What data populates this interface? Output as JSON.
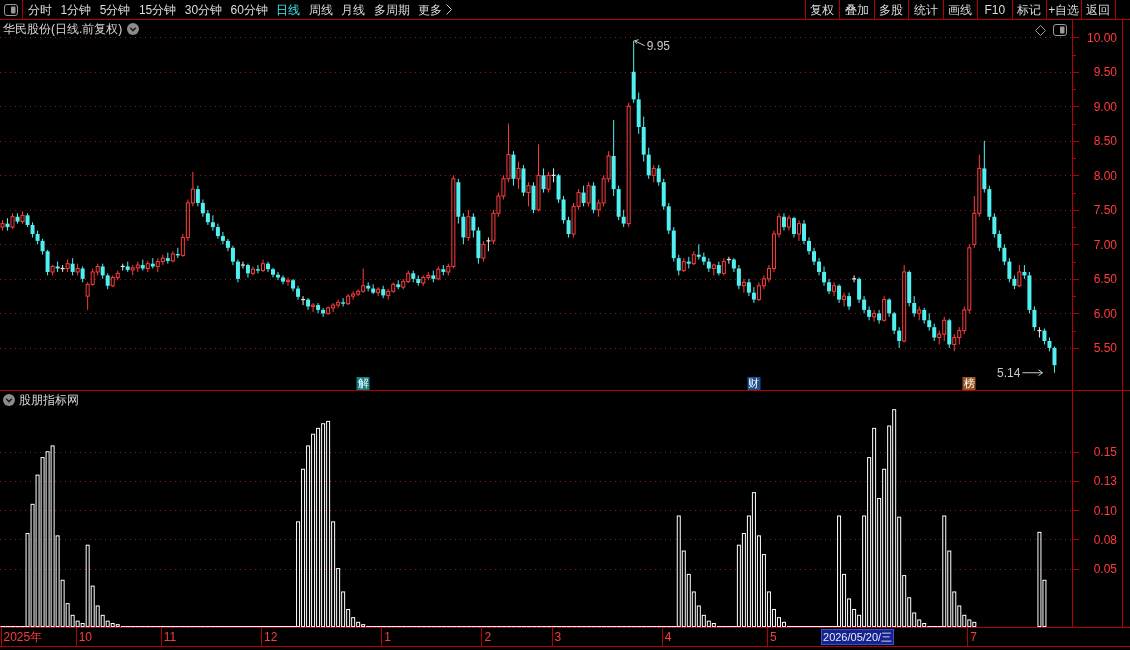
{
  "toolbar": {
    "periods": [
      {
        "label": "分时",
        "selected": false
      },
      {
        "label": "1分钟",
        "selected": false
      },
      {
        "label": "5分钟",
        "selected": false
      },
      {
        "label": "15分钟",
        "selected": false
      },
      {
        "label": "30分钟",
        "selected": false
      },
      {
        "label": "60分钟",
        "selected": false
      },
      {
        "label": "日线",
        "selected": true
      },
      {
        "label": "周线",
        "selected": false
      },
      {
        "label": "月线",
        "selected": false
      },
      {
        "label": "多周期",
        "selected": false
      }
    ],
    "more_menu": {
      "label": "更多"
    },
    "buttons": [
      "复权",
      "叠加",
      "多股",
      "统计",
      "画线",
      "F10",
      "标记",
      "+自选",
      "返回"
    ]
  },
  "price_pane": {
    "title": "华民股份(日线.前复权)",
    "events": [
      {
        "label": "解",
        "color": "#0e7d80"
      },
      {
        "label": "财",
        "color": "#1f4e8c"
      },
      {
        "label": "榜",
        "color": "#9a5224"
      }
    ],
    "chart_data": [
      {
        "type": "candlestick",
        "ylim": [
          4.89,
          10.25
        ],
        "yticks": [
          {
            "value": 5.5,
            "label": "5.50"
          },
          {
            "value": 6,
            "label": "6.00"
          },
          {
            "value": 6.5,
            "label": "6.50"
          },
          {
            "value": 7,
            "label": "7.00"
          },
          {
            "value": 7.5,
            "label": "7.50"
          },
          {
            "value": 8,
            "label": "8.00"
          },
          {
            "value": 8.5,
            "label": "8.50"
          },
          {
            "value": 9,
            "label": "9.00"
          },
          {
            "value": 9.5,
            "label": "9.50"
          },
          {
            "value": 10,
            "label": "10.00"
          }
        ],
        "grid": true,
        "annotations": [
          "9.95",
          "5.14"
        ],
        "ohlc": [
          [
            7.25,
            7.35,
            7.2,
            7.3
          ],
          [
            7.3,
            7.38,
            7.2,
            7.25
          ],
          [
            7.25,
            7.45,
            7.22,
            7.4
          ],
          [
            7.4,
            7.45,
            7.3,
            7.33
          ],
          [
            7.33,
            7.48,
            7.3,
            7.42
          ],
          [
            7.42,
            7.45,
            7.25,
            7.28
          ],
          [
            7.28,
            7.32,
            7.1,
            7.15
          ],
          [
            7.15,
            7.2,
            7.0,
            7.05
          ],
          [
            7.05,
            7.08,
            6.85,
            6.9
          ],
          [
            6.9,
            6.92,
            6.55,
            6.6
          ],
          [
            6.6,
            6.7,
            6.55,
            6.68
          ],
          [
            6.68,
            6.75,
            6.6,
            6.65
          ],
          [
            6.65,
            6.7,
            6.6,
            6.65
          ],
          [
            6.65,
            6.78,
            6.6,
            6.72
          ],
          [
            6.72,
            6.8,
            6.55,
            6.6
          ],
          [
            6.6,
            6.72,
            6.55,
            6.65
          ],
          [
            6.65,
            6.68,
            6.45,
            6.5
          ],
          [
            6.25,
            6.45,
            6.05,
            6.42
          ],
          [
            6.42,
            6.65,
            6.4,
            6.6
          ],
          [
            6.6,
            6.72,
            6.55,
            6.68
          ],
          [
            6.68,
            6.72,
            6.5,
            6.55
          ],
          [
            6.55,
            6.58,
            6.35,
            6.4
          ],
          [
            6.4,
            6.55,
            6.38,
            6.52
          ],
          [
            6.52,
            6.62,
            6.48,
            6.58
          ],
          [
            6.68,
            6.72,
            6.62,
            6.68
          ],
          [
            6.68,
            6.75,
            6.6,
            6.63
          ],
          [
            6.63,
            6.7,
            6.55,
            6.66
          ],
          [
            6.66,
            6.75,
            6.6,
            6.7
          ],
          [
            6.7,
            6.78,
            6.62,
            6.65
          ],
          [
            6.65,
            6.76,
            6.6,
            6.72
          ],
          [
            6.72,
            6.8,
            6.65,
            6.68
          ],
          [
            6.68,
            6.8,
            6.6,
            6.75
          ],
          [
            6.75,
            6.85,
            6.7,
            6.8
          ],
          [
            6.8,
            6.88,
            6.72,
            6.76
          ],
          [
            6.76,
            6.9,
            6.74,
            6.86
          ],
          [
            6.86,
            6.95,
            6.8,
            6.84
          ],
          [
            6.84,
            7.15,
            6.82,
            7.1
          ],
          [
            7.1,
            7.65,
            7.05,
            7.6
          ],
          [
            7.6,
            8.05,
            7.55,
            7.8
          ],
          [
            7.8,
            7.85,
            7.55,
            7.6
          ],
          [
            7.6,
            7.65,
            7.4,
            7.45
          ],
          [
            7.45,
            7.5,
            7.28,
            7.32
          ],
          [
            7.32,
            7.42,
            7.2,
            7.25
          ],
          [
            7.25,
            7.3,
            7.08,
            7.12
          ],
          [
            7.12,
            7.18,
            7.0,
            7.05
          ],
          [
            7.05,
            7.08,
            6.9,
            6.95
          ],
          [
            6.95,
            6.98,
            6.7,
            6.75
          ],
          [
            6.75,
            6.78,
            6.45,
            6.5
          ],
          [
            6.7,
            6.75,
            6.65,
            6.7
          ],
          [
            6.7,
            6.72,
            6.52,
            6.58
          ],
          [
            6.58,
            6.68,
            6.55,
            6.64
          ],
          [
            6.64,
            6.7,
            6.58,
            6.62
          ],
          [
            6.62,
            6.78,
            6.6,
            6.72
          ],
          [
            6.72,
            6.75,
            6.6,
            6.64
          ],
          [
            6.64,
            6.66,
            6.52,
            6.56
          ],
          [
            6.56,
            6.6,
            6.48,
            6.52
          ],
          [
            6.52,
            6.55,
            6.42,
            6.46
          ],
          [
            6.46,
            6.52,
            6.4,
            6.48
          ],
          [
            6.48,
            6.5,
            6.32,
            6.36
          ],
          [
            6.36,
            6.4,
            6.2,
            6.24
          ],
          [
            6.2,
            6.25,
            6.12,
            6.2
          ],
          [
            6.2,
            6.22,
            6.05,
            6.1
          ],
          [
            6.1,
            6.15,
            6.02,
            6.12
          ],
          [
            6.12,
            6.15,
            6.0,
            6.05
          ],
          [
            6.05,
            6.08,
            5.95,
            6.0
          ],
          [
            6.0,
            6.1,
            5.98,
            6.08
          ],
          [
            6.08,
            6.15,
            6.02,
            6.12
          ],
          [
            6.12,
            6.2,
            6.08,
            6.16
          ],
          [
            6.16,
            6.22,
            6.1,
            6.14
          ],
          [
            6.14,
            6.28,
            6.12,
            6.25
          ],
          [
            6.25,
            6.32,
            6.2,
            6.28
          ],
          [
            6.28,
            6.35,
            6.25,
            6.32
          ],
          [
            6.32,
            6.65,
            6.3,
            6.4
          ],
          [
            6.4,
            6.45,
            6.32,
            6.36
          ],
          [
            6.36,
            6.42,
            6.28,
            6.3
          ],
          [
            6.3,
            6.38,
            6.25,
            6.35
          ],
          [
            6.35,
            6.4,
            6.22,
            6.26
          ],
          [
            6.26,
            6.35,
            6.2,
            6.32
          ],
          [
            6.32,
            6.45,
            6.3,
            6.42
          ],
          [
            6.42,
            6.48,
            6.35,
            6.38
          ],
          [
            6.38,
            6.5,
            6.35,
            6.46
          ],
          [
            6.46,
            6.62,
            6.44,
            6.58
          ],
          [
            6.58,
            6.62,
            6.45,
            6.5
          ],
          [
            6.5,
            6.55,
            6.4,
            6.44
          ],
          [
            6.44,
            6.55,
            6.4,
            6.52
          ],
          [
            6.52,
            6.6,
            6.48,
            6.55
          ],
          [
            6.55,
            6.62,
            6.45,
            6.5
          ],
          [
            6.5,
            6.68,
            6.48,
            6.64
          ],
          [
            6.64,
            6.7,
            6.55,
            6.6
          ],
          [
            6.6,
            6.72,
            6.55,
            6.68
          ],
          [
            6.68,
            8.0,
            6.65,
            7.95
          ],
          [
            7.9,
            7.95,
            7.3,
            7.4
          ],
          [
            7.4,
            7.45,
            7.0,
            7.1
          ],
          [
            7.1,
            7.5,
            7.05,
            7.4
          ],
          [
            7.4,
            7.45,
            7.1,
            7.2
          ],
          [
            7.2,
            7.25,
            6.72,
            6.8
          ],
          [
            6.8,
            7.05,
            6.75,
            7.0
          ],
          [
            7.05,
            7.1,
            6.9,
            7.05
          ],
          [
            7.05,
            7.5,
            7.0,
            7.45
          ],
          [
            7.45,
            7.75,
            7.4,
            7.7
          ],
          [
            7.7,
            8.0,
            7.65,
            7.95
          ],
          [
            7.95,
            8.75,
            7.9,
            8.3
          ],
          [
            8.3,
            8.35,
            7.85,
            7.95
          ],
          [
            7.95,
            8.2,
            7.8,
            8.1
          ],
          [
            8.1,
            8.15,
            7.7,
            7.75
          ],
          [
            7.75,
            7.9,
            7.55,
            7.85
          ],
          [
            7.85,
            7.9,
            7.45,
            7.5
          ],
          [
            7.5,
            8.45,
            7.48,
            8.0
          ],
          [
            8.0,
            8.1,
            7.75,
            7.8
          ],
          [
            7.8,
            8.05,
            7.75,
            8.0
          ],
          [
            8.0,
            8.1,
            7.9,
            8.0
          ],
          [
            8.0,
            8.02,
            7.6,
            7.65
          ],
          [
            7.65,
            7.7,
            7.3,
            7.35
          ],
          [
            7.35,
            7.4,
            7.1,
            7.15
          ],
          [
            7.15,
            7.6,
            7.1,
            7.55
          ],
          [
            7.55,
            7.8,
            7.5,
            7.75
          ],
          [
            7.75,
            7.85,
            7.55,
            7.6
          ],
          [
            7.6,
            7.9,
            7.55,
            7.85
          ],
          [
            7.85,
            7.9,
            7.45,
            7.5
          ],
          [
            7.5,
            7.65,
            7.4,
            7.6
          ],
          [
            7.6,
            8.0,
            7.55,
            7.95
          ],
          [
            7.95,
            8.35,
            7.9,
            8.28
          ],
          [
            8.28,
            8.8,
            7.7,
            7.8
          ],
          [
            7.8,
            7.85,
            7.35,
            7.4
          ],
          [
            7.4,
            7.5,
            7.25,
            7.3
          ],
          [
            7.3,
            9.05,
            7.25,
            9.0
          ],
          [
            9.5,
            9.95,
            9.05,
            9.1
          ],
          [
            9.1,
            9.2,
            8.6,
            8.7
          ],
          [
            8.7,
            8.85,
            8.2,
            8.3
          ],
          [
            8.3,
            8.4,
            7.95,
            8.0
          ],
          [
            8.0,
            8.15,
            7.9,
            8.1
          ],
          [
            8.1,
            8.15,
            7.85,
            7.9
          ],
          [
            7.9,
            7.95,
            7.5,
            7.55
          ],
          [
            7.55,
            7.6,
            7.15,
            7.2
          ],
          [
            7.2,
            7.25,
            6.75,
            6.8
          ],
          [
            6.8,
            6.85,
            6.55,
            6.62
          ],
          [
            6.62,
            6.8,
            6.6,
            6.75
          ],
          [
            6.75,
            6.82,
            6.65,
            6.72
          ],
          [
            6.72,
            6.9,
            6.7,
            6.85
          ],
          [
            6.85,
            7.0,
            6.78,
            6.82
          ],
          [
            6.82,
            6.88,
            6.7,
            6.75
          ],
          [
            6.75,
            6.8,
            6.6,
            6.65
          ],
          [
            6.65,
            6.72,
            6.55,
            6.7
          ],
          [
            6.7,
            6.75,
            6.55,
            6.58
          ],
          [
            6.58,
            6.8,
            6.55,
            6.75
          ],
          [
            6.78,
            6.82,
            6.72,
            6.78
          ],
          [
            6.78,
            6.8,
            6.6,
            6.65
          ],
          [
            6.65,
            6.7,
            6.35,
            6.4
          ],
          [
            6.4,
            6.5,
            6.3,
            6.45
          ],
          [
            6.45,
            6.5,
            6.25,
            6.3
          ],
          [
            6.3,
            6.38,
            6.15,
            6.2
          ],
          [
            6.2,
            6.45,
            6.18,
            6.4
          ],
          [
            6.4,
            6.55,
            6.35,
            6.5
          ],
          [
            6.5,
            6.7,
            6.45,
            6.65
          ],
          [
            6.65,
            7.2,
            6.6,
            7.15
          ],
          [
            7.15,
            7.45,
            7.1,
            7.4
          ],
          [
            7.4,
            7.45,
            7.2,
            7.25
          ],
          [
            7.25,
            7.42,
            7.2,
            7.38
          ],
          [
            7.38,
            7.4,
            7.1,
            7.15
          ],
          [
            7.15,
            7.35,
            7.05,
            7.3
          ],
          [
            7.3,
            7.35,
            7.0,
            7.05
          ],
          [
            7.05,
            7.1,
            6.85,
            6.9
          ],
          [
            6.9,
            6.95,
            6.7,
            6.75
          ],
          [
            6.75,
            6.8,
            6.55,
            6.6
          ],
          [
            6.6,
            6.68,
            6.4,
            6.45
          ],
          [
            6.45,
            6.5,
            6.28,
            6.32
          ],
          [
            6.32,
            6.45,
            6.25,
            6.4
          ],
          [
            6.4,
            6.42,
            6.15,
            6.2
          ],
          [
            6.2,
            6.3,
            6.1,
            6.25
          ],
          [
            6.25,
            6.3,
            6.05,
            6.1
          ],
          [
            6.5,
            6.55,
            6.45,
            6.5
          ],
          [
            6.5,
            6.52,
            6.15,
            6.2
          ],
          [
            6.2,
            6.25,
            6.0,
            6.05
          ],
          [
            6.05,
            6.1,
            5.9,
            5.95
          ],
          [
            5.95,
            6.05,
            5.88,
            6.0
          ],
          [
            6.0,
            6.05,
            5.85,
            5.9
          ],
          [
            5.9,
            6.25,
            5.88,
            6.2
          ],
          [
            6.2,
            6.22,
            5.95,
            6.0
          ],
          [
            6.0,
            6.02,
            5.7,
            5.75
          ],
          [
            5.75,
            5.8,
            5.5,
            5.6
          ],
          [
            5.6,
            6.7,
            5.58,
            6.6
          ],
          [
            6.6,
            6.62,
            6.1,
            6.15
          ],
          [
            6.15,
            6.25,
            5.95,
            6.0
          ],
          [
            6.0,
            6.1,
            5.9,
            6.05
          ],
          [
            6.05,
            6.08,
            5.85,
            5.9
          ],
          [
            5.9,
            6.0,
            5.75,
            5.8
          ],
          [
            5.8,
            5.85,
            5.6,
            5.65
          ],
          [
            5.65,
            5.75,
            5.55,
            5.7
          ],
          [
            5.7,
            5.95,
            5.6,
            5.9
          ],
          [
            5.9,
            5.92,
            5.5,
            5.55
          ],
          [
            5.55,
            5.7,
            5.45,
            5.65
          ],
          [
            5.65,
            5.8,
            5.55,
            5.75
          ],
          [
            5.75,
            6.1,
            5.7,
            6.05
          ],
          [
            6.05,
            7.0,
            6.0,
            6.95
          ],
          [
            7.0,
            7.7,
            6.95,
            7.45
          ],
          [
            7.45,
            8.3,
            7.4,
            8.1
          ],
          [
            8.1,
            8.5,
            7.75,
            7.8
          ],
          [
            7.8,
            7.85,
            7.35,
            7.4
          ],
          [
            7.4,
            7.45,
            7.1,
            7.15
          ],
          [
            7.15,
            7.2,
            6.9,
            6.95
          ],
          [
            6.95,
            7.0,
            6.7,
            6.75
          ],
          [
            6.75,
            6.8,
            6.45,
            6.5
          ],
          [
            6.5,
            6.55,
            6.35,
            6.4
          ],
          [
            6.4,
            6.7,
            6.38,
            6.6
          ],
          [
            6.6,
            6.7,
            6.5,
            6.55
          ],
          [
            6.55,
            6.6,
            6.0,
            6.05
          ],
          [
            6.05,
            6.1,
            5.75,
            5.8
          ],
          [
            5.75,
            5.8,
            5.65,
            5.75
          ],
          [
            5.75,
            5.78,
            5.55,
            5.6
          ],
          [
            5.6,
            5.65,
            5.45,
            5.5
          ],
          [
            5.5,
            5.52,
            5.14,
            5.25
          ],
          null,
          null,
          null
        ]
      }
    ]
  },
  "indicator_pane": {
    "title": "股朋指标网",
    "chart_data": [
      {
        "type": "bar",
        "ylim": [
          0,
          0.202
        ],
        "yticks": [
          {
            "value": 0.05,
            "label": "0.05"
          },
          {
            "value": 0.075,
            "label": "0.08"
          },
          {
            "value": 0.1,
            "label": "0.10"
          },
          {
            "value": 0.125,
            "label": "0.13"
          },
          {
            "value": 0.15,
            "label": "0.15"
          }
        ],
        "grid": true,
        "values": [
          0,
          0,
          0,
          0,
          0,
          0.08,
          0.105,
          0.13,
          0.145,
          0.15,
          0.155,
          0.078,
          0.04,
          0.02,
          0.01,
          0.005,
          0.003,
          0.07,
          0.035,
          0.018,
          0.01,
          0.005,
          0.003,
          0.002,
          0,
          0,
          0,
          0,
          0,
          0,
          0,
          0,
          0,
          0,
          0,
          0,
          0,
          0,
          0,
          0,
          0,
          0,
          0,
          0,
          0,
          0,
          0,
          0,
          0,
          0,
          0,
          0,
          0,
          0,
          0,
          0,
          0,
          0,
          0,
          0.09,
          0.135,
          0.155,
          0.165,
          0.17,
          0.174,
          0.176,
          0.09,
          0.05,
          0.03,
          0.015,
          0.008,
          0.004,
          0.002,
          0,
          0,
          0,
          0,
          0,
          0,
          0,
          0,
          0,
          0,
          0,
          0,
          0,
          0,
          0,
          0,
          0,
          0,
          0,
          0,
          0,
          0,
          0,
          0,
          0,
          0,
          0,
          0,
          0,
          0,
          0,
          0,
          0,
          0,
          0,
          0,
          0,
          0,
          0,
          0,
          0,
          0,
          0,
          0,
          0,
          0,
          0,
          0,
          0,
          0,
          0,
          0,
          0,
          0,
          0,
          0,
          0,
          0,
          0,
          0,
          0,
          0,
          0.095,
          0.065,
          0.045,
          0.03,
          0.018,
          0.01,
          0.005,
          0.003,
          0,
          0,
          0,
          0,
          0.07,
          0.08,
          0.095,
          0.115,
          0.078,
          0.062,
          0.03,
          0.015,
          0.008,
          0.004,
          0,
          0,
          0,
          0,
          0,
          0,
          0,
          0,
          0,
          0,
          0.095,
          0.045,
          0.024,
          0.015,
          0.01,
          0.095,
          0.145,
          0.17,
          0.11,
          0.135,
          0.172,
          0.186,
          0.094,
          0.044,
          0.025,
          0.012,
          0.006,
          0.003,
          0,
          0,
          0,
          0.095,
          0.065,
          0.03,
          0.018,
          0.01,
          0.006,
          0.004,
          null,
          null,
          null,
          null,
          null,
          null,
          null,
          null,
          null,
          null,
          null,
          null,
          0.081,
          0.04,
          null,
          null,
          null,
          null,
          null
        ]
      }
    ]
  },
  "time_axis": {
    "labels": [
      "2025年",
      "10",
      "11",
      "12",
      "1",
      "2",
      "3",
      "4",
      "5",
      "7"
    ],
    "cursor_label": "2026/05/20/三"
  }
}
